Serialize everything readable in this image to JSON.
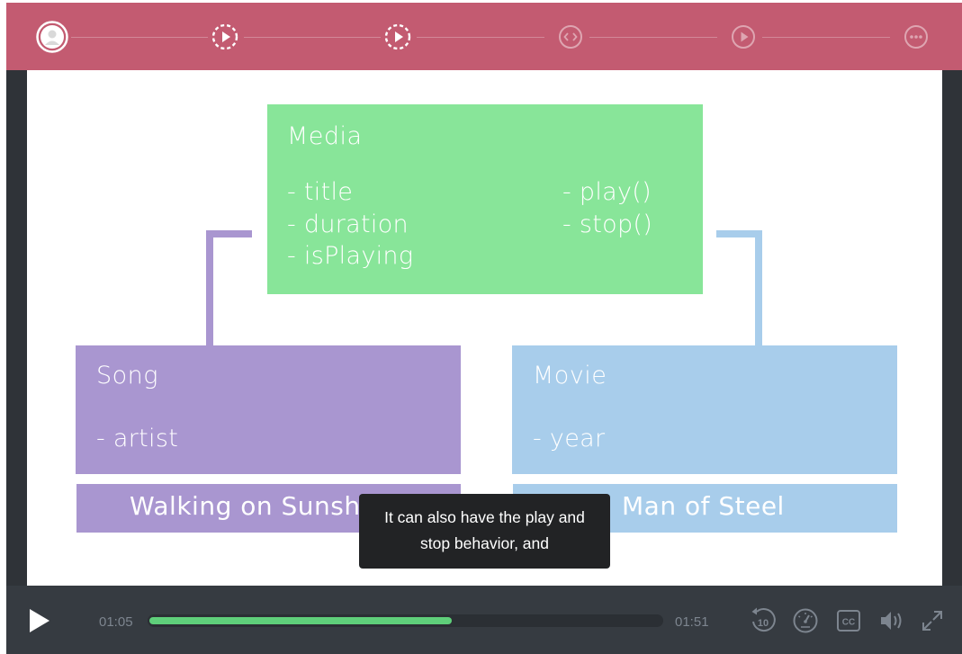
{
  "colors": {
    "step_bar": "#c35b71",
    "media_box": "#88e599",
    "song_box": "#a996d0",
    "movie_box": "#a8cdeb",
    "progress_fill": "#5fcf7a",
    "controls_bg": "#363b41"
  },
  "steps": [
    {
      "icon": "user-avatar-icon",
      "state": "done"
    },
    {
      "icon": "play-circle-icon",
      "state": "active"
    },
    {
      "icon": "play-circle-icon",
      "state": "active"
    },
    {
      "icon": "code-icon",
      "state": "locked"
    },
    {
      "icon": "play-circle-icon",
      "state": "locked"
    },
    {
      "icon": "more-dots-icon",
      "state": "locked"
    }
  ],
  "diagram": {
    "media": {
      "title": "Media",
      "attributes": [
        "- title",
        "- duration",
        "- isPlaying"
      ],
      "methods": [
        "- play()",
        "- stop()"
      ]
    },
    "song": {
      "title": "Song",
      "attributes": [
        "- artist"
      ],
      "example": "Walking on Sunshine"
    },
    "movie": {
      "title": "Movie",
      "attributes": [
        "- year"
      ],
      "example": "Man of Steel"
    }
  },
  "caption": {
    "line1": "It can also have the play and",
    "line2": "stop behavior, and"
  },
  "player": {
    "current_time": "01:05",
    "duration": "01:51",
    "progress": 0.59,
    "icons": {
      "play": "play-icon",
      "rewind": "rewind-10-icon",
      "speed": "speed-gauge-icon",
      "cc": "closed-captions-icon",
      "volume": "volume-icon",
      "fullscreen": "fullscreen-icon"
    },
    "rewind_label": "10",
    "cc_label": "CC"
  }
}
